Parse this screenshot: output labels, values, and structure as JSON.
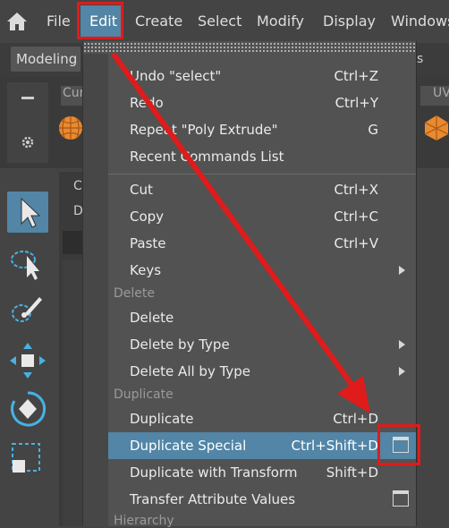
{
  "menubar": {
    "items": [
      "File",
      "Edit",
      "Create",
      "Select",
      "Modify",
      "Display",
      "Windows"
    ],
    "active": "Edit"
  },
  "toolbar": {
    "mode_selector": "Modeling",
    "right_fragment": "s",
    "shelf_tab_left": "Cur",
    "shelf_tab_right": "UV"
  },
  "viewport": {
    "label_c": "C",
    "label_d": "D"
  },
  "edit_menu": {
    "items": [
      {
        "label": "Undo \"select\"",
        "shortcut": "Ctrl+Z"
      },
      {
        "label": "Redo",
        "shortcut": "Ctrl+Y"
      },
      {
        "label": "Repeat \"Poly Extrude\"",
        "shortcut": "G"
      },
      {
        "label": "Recent Commands List",
        "shortcut": ""
      },
      {
        "label": "Cut",
        "shortcut": "Ctrl+X"
      },
      {
        "label": "Copy",
        "shortcut": "Ctrl+C"
      },
      {
        "label": "Paste",
        "shortcut": "Ctrl+V"
      },
      {
        "label": "Keys",
        "shortcut": ""
      },
      {
        "label": "Delete",
        "shortcut": ""
      },
      {
        "label": "Delete by Type",
        "shortcut": ""
      },
      {
        "label": "Delete All by Type",
        "shortcut": ""
      },
      {
        "label": "Duplicate",
        "shortcut": "Ctrl+D"
      },
      {
        "label": "Duplicate Special",
        "shortcut": "Ctrl+Shift+D"
      },
      {
        "label": "Duplicate with Transform",
        "shortcut": "Shift+D"
      },
      {
        "label": "Transfer Attribute Values",
        "shortcut": ""
      }
    ],
    "sections": {
      "delete": "Delete",
      "duplicate": "Duplicate",
      "hierarchy": "Hierarchy"
    },
    "highlighted": "Duplicate Special"
  },
  "colors": {
    "accent": "#5285a6",
    "menu_bg": "#525252",
    "annotation": "#e01b1b"
  }
}
